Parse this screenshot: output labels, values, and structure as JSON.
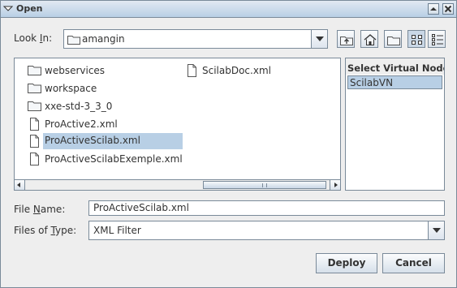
{
  "window": {
    "title": "Open"
  },
  "lookin": {
    "label_pre": "Look ",
    "label_key": "I",
    "label_post": "n:",
    "value": "amangin"
  },
  "files": [
    {
      "name": "webservices",
      "type": "folder"
    },
    {
      "name": "workspace",
      "type": "folder"
    },
    {
      "name": "xxe-std-3_3_0",
      "type": "folder"
    },
    {
      "name": "ProActive2.xml",
      "type": "file"
    },
    {
      "name": "ProActiveScilab.xml",
      "type": "file",
      "selected": true
    },
    {
      "name": "ProActiveScilabExemple.xml",
      "type": "file"
    },
    {
      "name": "ScilabDoc.xml",
      "type": "file"
    }
  ],
  "virtual_node": {
    "header": "Select Virtual Node",
    "items": [
      "ScilabVN"
    ]
  },
  "file_name": {
    "label_pre": "File ",
    "label_key": "N",
    "label_post": "ame:",
    "value": "ProActiveScilab.xml"
  },
  "file_type": {
    "label_pre": "Files of ",
    "label_key": "T",
    "label_post": "ype:",
    "value": "XML Filter"
  },
  "buttons": {
    "deploy": "Deploy",
    "cancel": "Cancel"
  },
  "colors": {
    "selection": "#b8cfe5",
    "border": "#7a8a99",
    "background": "#eeeeee"
  }
}
